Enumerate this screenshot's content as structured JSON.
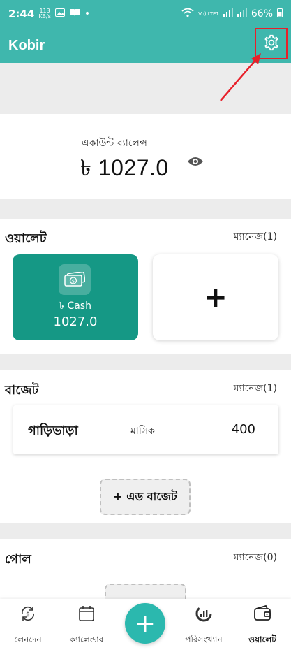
{
  "status_bar": {
    "time": "2:44",
    "data_rate": "113",
    "data_unit": "KB/s",
    "dot": "•",
    "network_label": "Vo) LTE1",
    "battery": "66%"
  },
  "app_bar": {
    "title": "Kobir",
    "settings_icon": "gear-icon"
  },
  "balance": {
    "label": "একাউন্ট ব্যালেন্স",
    "amount": "৳ 1027.0",
    "visibility_icon": "eye-icon"
  },
  "wallet": {
    "title": "ওয়ালেট",
    "manage": "ম্যানেজ(1)",
    "cards": [
      {
        "name": "৳ Cash",
        "balance": "1027.0",
        "icon": "cash-icon"
      }
    ],
    "add_label": "+"
  },
  "budget": {
    "title": "বাজেট",
    "manage": "ম্যানেজ(1)",
    "items": [
      {
        "name": "গাড়িভাড়া",
        "period": "মাসিক",
        "amount": "400"
      }
    ],
    "add_button": "+ এড বাজেট"
  },
  "goal": {
    "title": "গোল",
    "manage": "ম্যানেজ(0)"
  },
  "bottom_nav": {
    "items": [
      {
        "label": "লেনদেন",
        "icon": "transaction-icon"
      },
      {
        "label": "ক্যালেন্ডার",
        "icon": "calendar-icon"
      },
      {
        "label": "পরিসংখ্যান",
        "icon": "statistics-icon"
      },
      {
        "label": "ওয়ালেট",
        "icon": "wallet-icon"
      }
    ],
    "fab_label": "+",
    "active": "ওয়ালেট"
  },
  "colors": {
    "primary": "#3fb7ad",
    "wallet_card": "#159885",
    "annotation": "#e8202a"
  }
}
